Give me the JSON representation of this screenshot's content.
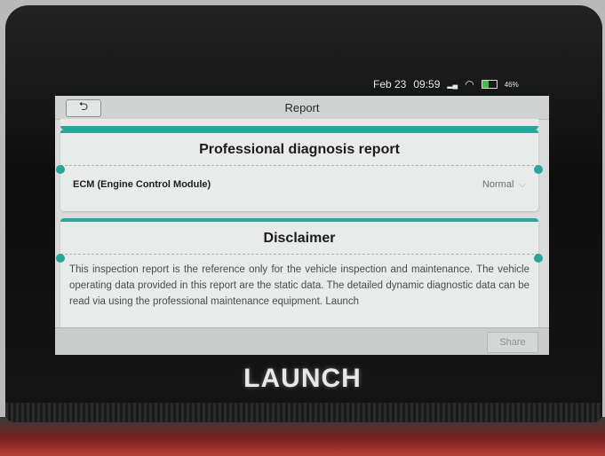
{
  "status_bar": {
    "date": "Feb 23",
    "time": "09:59",
    "battery_percent": "46%",
    "icons": [
      "signal-icon",
      "wifi-icon",
      "battery-icon"
    ]
  },
  "header": {
    "title": "Report",
    "back_icon": "back-arrow-icon"
  },
  "diagnosis_card": {
    "heading": "Professional diagnosis report",
    "items": [
      {
        "label": "ECM (Engine Control Module)",
        "status": "Normal"
      }
    ]
  },
  "disclaimer_card": {
    "heading": "Disclaimer",
    "text": "This inspection report is the reference only for the vehicle inspection and maintenance. The vehicle operating data provided in this report are the static data. The detailed dynamic diagnostic data can be read via using the professional maintenance equipment. Launch"
  },
  "footer": {
    "share_label": "Share"
  },
  "device": {
    "brand": "LAUNCH"
  },
  "colors": {
    "accent": "#2aa59b",
    "screen_bg": "#d9dcdb",
    "card_bg": "#e9ebea"
  }
}
